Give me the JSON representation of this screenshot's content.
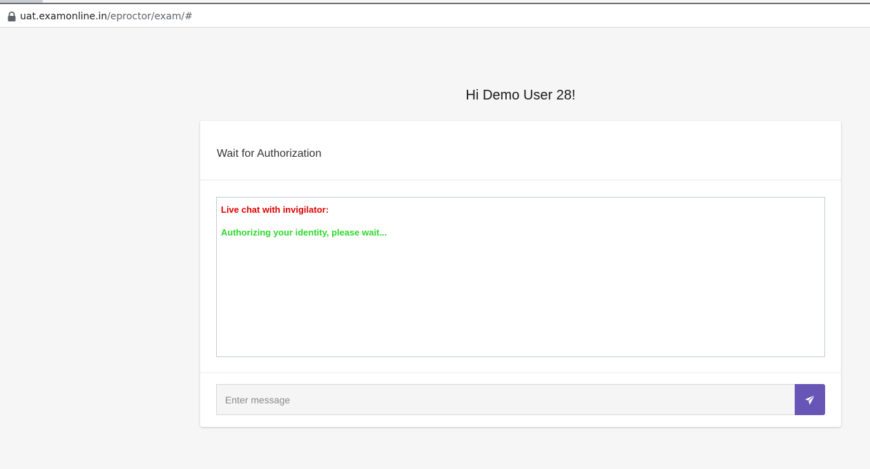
{
  "browser": {
    "url_host": "uat.examonline.in",
    "url_path": "/eproctor/exam/#"
  },
  "page": {
    "greeting": "Hi Demo User 28!"
  },
  "card": {
    "title": "Wait for Authorization",
    "chat": {
      "label": "Live chat with invigilator:",
      "messages": [
        {
          "text": "Authorizing your identity, please wait..."
        }
      ]
    },
    "composer": {
      "placeholder": "Enter message",
      "value": "",
      "send_icon": "paper-plane-icon"
    }
  },
  "colors": {
    "label_red": "#e00000",
    "message_green": "#2cd82c",
    "send_button": "#6756b5"
  }
}
